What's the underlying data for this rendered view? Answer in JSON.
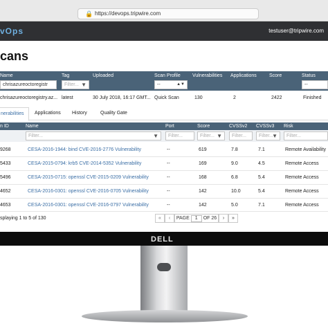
{
  "browser": {
    "url": "https://devops.tripwire.com"
  },
  "app": {
    "brand": "vOps",
    "user": "testuser@tripwire.com",
    "page_title": "cans"
  },
  "scan_table": {
    "columns": [
      "Name",
      "Tag",
      "Uploaded",
      "Scan Profile",
      "Vulnerabilities",
      "Applications",
      "Score",
      "Status"
    ],
    "filters": {
      "name": "chrisazureoctoregistr",
      "tag": "Filter...",
      "scan_profile": "--",
      "status": "--"
    },
    "row": {
      "name": "chrisazureoctoregistry.az...",
      "tag": "latest",
      "uploaded": "30 July 2018, 16:17 GMT...",
      "scan_profile": "Quick Scan",
      "vulnerabilities": "130",
      "applications": "2",
      "score": "2422",
      "status": "Finished"
    }
  },
  "tabs": [
    "nerabilities",
    "Applications",
    "History",
    "Quality Gate"
  ],
  "vuln_table": {
    "columns": [
      "n ID",
      "Name",
      "Port",
      "Score",
      "CVSSv2",
      "CVSSv3",
      "Risk"
    ],
    "filter_placeholder": "Filter...",
    "rows": [
      {
        "id": "9268",
        "name": "CESA-2016-1944: bind CVE-2016-2776 Vulnerability",
        "port": "--",
        "score": "619",
        "cvss2": "7.8",
        "cvss3": "7.1",
        "risk": "Remote Availability"
      },
      {
        "id": "5433",
        "name": "CESA-2015-0794: krb5 CVE-2014-5352 Vulnerability",
        "port": "--",
        "score": "169",
        "cvss2": "9.0",
        "cvss3": "4.5",
        "risk": "Remote Access"
      },
      {
        "id": "5496",
        "name": "CESA-2015-0715: openssl CVE-2015-0209 Vulnerability",
        "port": "--",
        "score": "168",
        "cvss2": "6.8",
        "cvss3": "5.4",
        "risk": "Remote Access"
      },
      {
        "id": "4652",
        "name": "CESA-2016-0301: openssl CVE-2016-0705 Vulnerability",
        "port": "--",
        "score": "142",
        "cvss2": "10.0",
        "cvss3": "5.4",
        "risk": "Remote Access"
      },
      {
        "id": "4653",
        "name": "CESA-2016-0301: openssl CVE-2016-0797 Vulnerability",
        "port": "--",
        "score": "142",
        "cvss2": "5.0",
        "cvss3": "7.1",
        "risk": "Remote Access"
      }
    ]
  },
  "pager": {
    "summary": "splaying 1 to 5 of 130",
    "page_label": "PAGE",
    "page": "1",
    "of_label": "OF 26"
  },
  "monitor": {
    "logo": "DELL"
  }
}
